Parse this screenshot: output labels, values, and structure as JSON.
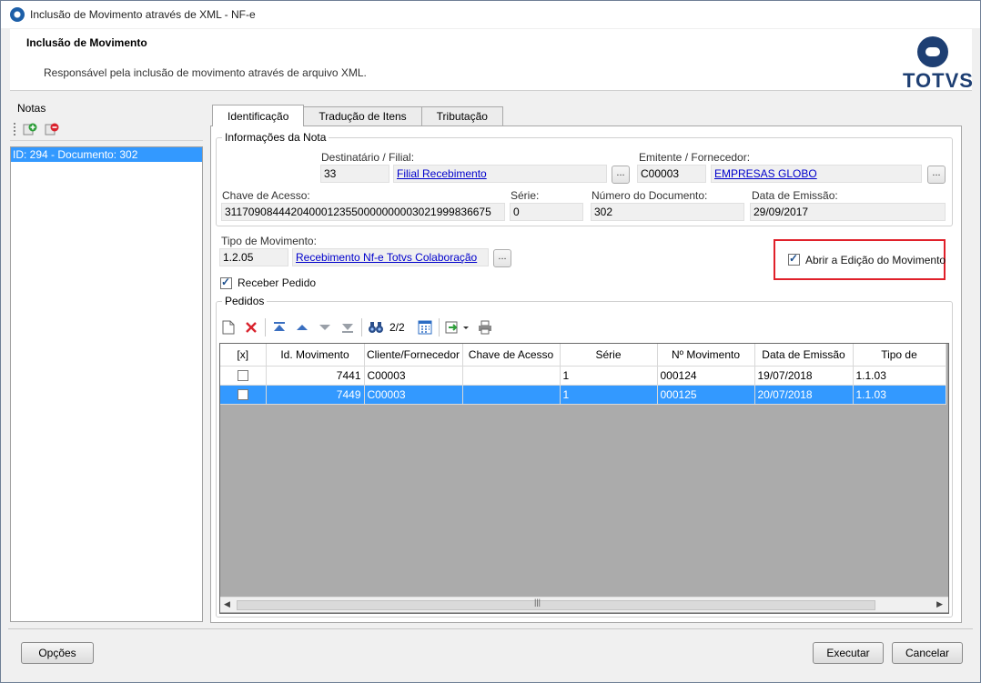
{
  "window": {
    "title": "Inclusão de Movimento através de XML - NF-e"
  },
  "header": {
    "title": "Inclusão de Movimento",
    "description": "Responsável pela inclusão de movimento através de arquivo XML.",
    "logo_text": "TOTVS"
  },
  "notas": {
    "label": "Notas",
    "items": [
      "ID: 294 - Documento: 302"
    ]
  },
  "tabs": [
    "Identificação",
    "Tradução de Itens",
    "Tributação"
  ],
  "nota_info": {
    "legend": "Informações da Nota",
    "destinatario_label": "Destinatário / Filial:",
    "destinatario_code": "33",
    "destinatario_name": "Filial Recebimento",
    "emitente_label": "Emitente / Fornecedor:",
    "emitente_code": "C00003",
    "emitente_name": "EMPRESAS GLOBO",
    "chave_label": "Chave de Acesso:",
    "chave_value": "31170908444204000123550000000003021999836675",
    "serie_label": "Série:",
    "serie_value": "0",
    "numero_label": "Número do Documento:",
    "numero_value": "302",
    "data_label": "Data de Emissão:",
    "data_value": "29/09/2017"
  },
  "movimento": {
    "tipo_label": "Tipo de Movimento:",
    "tipo_code": "1.2.05",
    "tipo_name": "Recebimento Nf-e Totvs Colaboração",
    "abrir_edicao_label": "Abrir a Edição do Movimento",
    "abrir_edicao_checked": true,
    "receber_pedido_label": "Receber Pedido",
    "receber_pedido_checked": true
  },
  "pedidos": {
    "legend": "Pedidos",
    "record_count": "2/2",
    "columns": [
      "[x]",
      "Id. Movimento",
      "Cliente/Fornecedor",
      "Chave de Acesso",
      "Série",
      "Nº Movimento",
      "Data de Emissão",
      "Tipo de"
    ],
    "rows": [
      {
        "checked": false,
        "id": "7441",
        "cliente": "C00003",
        "chave": "",
        "serie": "1",
        "numero": "000124",
        "data": "19/07/2018",
        "tipo": "1.1.03",
        "selected": false
      },
      {
        "checked": false,
        "id": "7449",
        "cliente": "C00003",
        "chave": "",
        "serie": "1",
        "numero": "000125",
        "data": "20/07/2018",
        "tipo": "1.1.03",
        "selected": true
      }
    ]
  },
  "buttons": {
    "dots": "...",
    "opcoes": "Opções",
    "executar": "Executar",
    "cancelar": "Cancelar"
  },
  "colors": {
    "selection": "#3399ff",
    "highlight": "#e0202a",
    "brand": "#1e3f73"
  }
}
